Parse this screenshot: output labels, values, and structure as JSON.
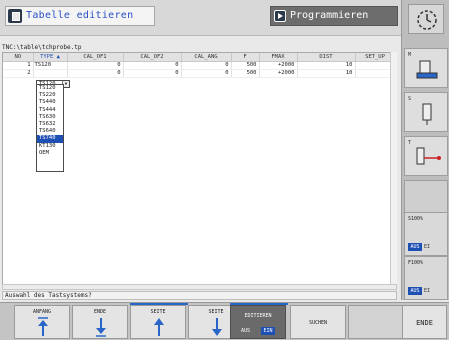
{
  "header": {
    "title": "Tabelle editieren",
    "mode": "Programmieren"
  },
  "path": "TNC:\\table\\tchprobe.tp",
  "table": {
    "columns": [
      "NO",
      "TYPE",
      "CAL_OF1",
      "CAL_OF2",
      "CAL_ANG",
      "F",
      "FMAX",
      "DIST",
      "SET_UP"
    ],
    "type_sort_glyph": "▲",
    "rows": [
      {
        "no": "1",
        "type": "TS120",
        "cal_of1": "0",
        "cal_of2": "0",
        "cal_ang": "0",
        "f": "500",
        "fmax": "+2000",
        "dist": "10",
        "set_up": ""
      },
      {
        "no": "2",
        "type": "TS120",
        "cal_of1": "0",
        "cal_of2": "0",
        "cal_ang": "0",
        "f": "500",
        "fmax": "+2000",
        "dist": "10",
        "set_up": ""
      }
    ]
  },
  "dropdown": {
    "combo_glyph": "▼",
    "options": [
      "TS120",
      "TS220",
      "TS440",
      "TS444",
      "TS630",
      "TS632",
      "TS640",
      "TS740",
      "KT130",
      "OEM"
    ],
    "selected": "TS740"
  },
  "status_line": "Auswahl des Tastsystems?",
  "right_softkeys": [
    {
      "label": "M"
    },
    {
      "label": "S"
    },
    {
      "label": "T"
    }
  ],
  "overrides": [
    {
      "pct": "S100%",
      "aus": "AUS",
      "ein": "EI"
    },
    {
      "pct": "F100%",
      "aus": "AUS",
      "ein": "EI"
    }
  ],
  "bottom_softkeys": {
    "anfang": "ANFANG",
    "ende_arrow": "ENDE",
    "seite_up": "SEITE",
    "seite_down": "SEITE",
    "editieren": "EDITIEREN",
    "edit_aus": "AUS",
    "edit_ein": "EIN",
    "suchen": "SUCHEN",
    "ende": "ENDE"
  },
  "colors": {
    "accent": "#1e50b4",
    "title": "#2a4fc6",
    "mode_bg": "#6d6d6d"
  }
}
